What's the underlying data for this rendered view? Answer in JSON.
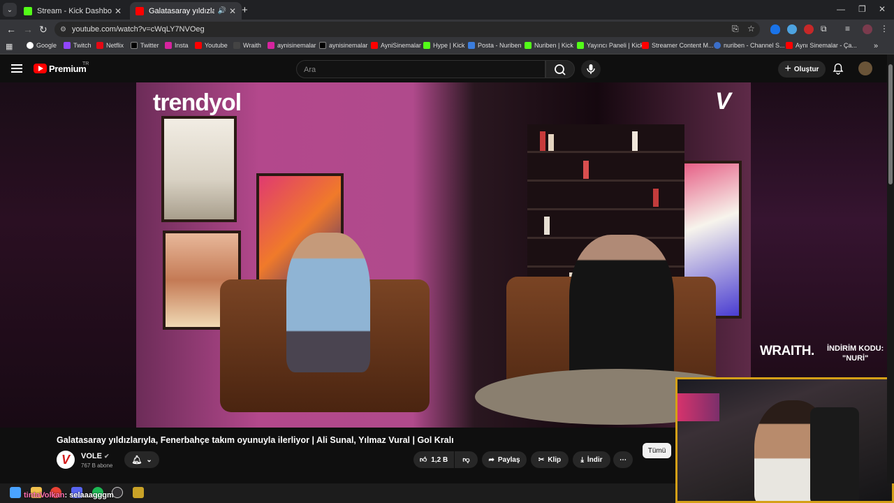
{
  "browser": {
    "tabs": [
      {
        "title": "Stream - Kick Dashboard",
        "active": false
      },
      {
        "title": "Galatasaray yıldızlarıyla, Fenerbahçe",
        "active": true
      }
    ],
    "url": "youtube.com/watch?v=cWqLY7NVOeg",
    "bookmarks": [
      "Google",
      "Twitch",
      "Netflix",
      "Twitter",
      "Insta",
      "Youtube",
      "Wraith",
      "aynisinemalar",
      "aynisinemalar",
      "AyniSinemalar",
      "Hype | Kick",
      "Posta - Nuriben",
      "Nuriben | Kick",
      "Yayıncı Paneli | Kick",
      "Streamer Content M...",
      "nuriben - Channel S...",
      "Aynı Sinemalar - Ça..."
    ]
  },
  "youtube": {
    "premium_label": "Premium",
    "region": "TR",
    "search_placeholder": "Ara",
    "create_label": "Oluştur"
  },
  "video": {
    "brand_text": "trendyol",
    "ad_brand": "WRAITH.",
    "ad_line1": "İNDİRİM KODU:",
    "ad_line2": "\"NURİ\"",
    "title": "Galatasaray yıldızlarıyla, Fenerbahçe takım oyunuyla ilerliyor | Ali Sunal, Yılmaz Vural | Gol Kralı",
    "channel": "VOLE",
    "subscribers": "767 B abone",
    "likes": "1,2 B",
    "share_label": "Paylaş",
    "clip_label": "Klip",
    "download_label": "İndir",
    "filter_label": "Tümü"
  },
  "chat": {
    "user": "tintaVolkan",
    "message": ": selaaagggm"
  },
  "colors": {
    "youtube_red": "#ff0000",
    "kick_green": "#53fc18",
    "webcam_border": "#d4a017"
  }
}
